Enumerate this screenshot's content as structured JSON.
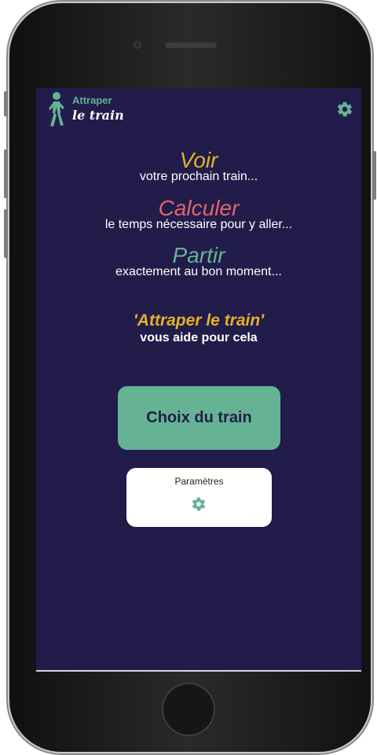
{
  "app": {
    "logo_line1": "Attraper",
    "logo_line2": "le train",
    "header_settings_icon": "gear-icon",
    "logo_icon": "walking-person-icon"
  },
  "taglines": [
    {
      "word": "Voir",
      "subtext": "votre prochain train...",
      "color": "#e3b127"
    },
    {
      "word": "Calculer",
      "subtext": "le temps nécessaire pour y aller...",
      "color": "#e2646f"
    },
    {
      "word": "Partir",
      "subtext": "exactement au bon moment...",
      "color": "#65b394"
    }
  ],
  "slogan": {
    "title": "'Attraper le train'",
    "subtitle": "vous aide pour cela"
  },
  "buttons": {
    "choose_train": "Choix du train",
    "settings_label": "Paramètres",
    "settings_icon": "gear-icon"
  },
  "colors": {
    "background": "#221c4b",
    "accent_green": "#65b394",
    "accent_yellow": "#e3b127",
    "accent_red": "#e2646f"
  }
}
